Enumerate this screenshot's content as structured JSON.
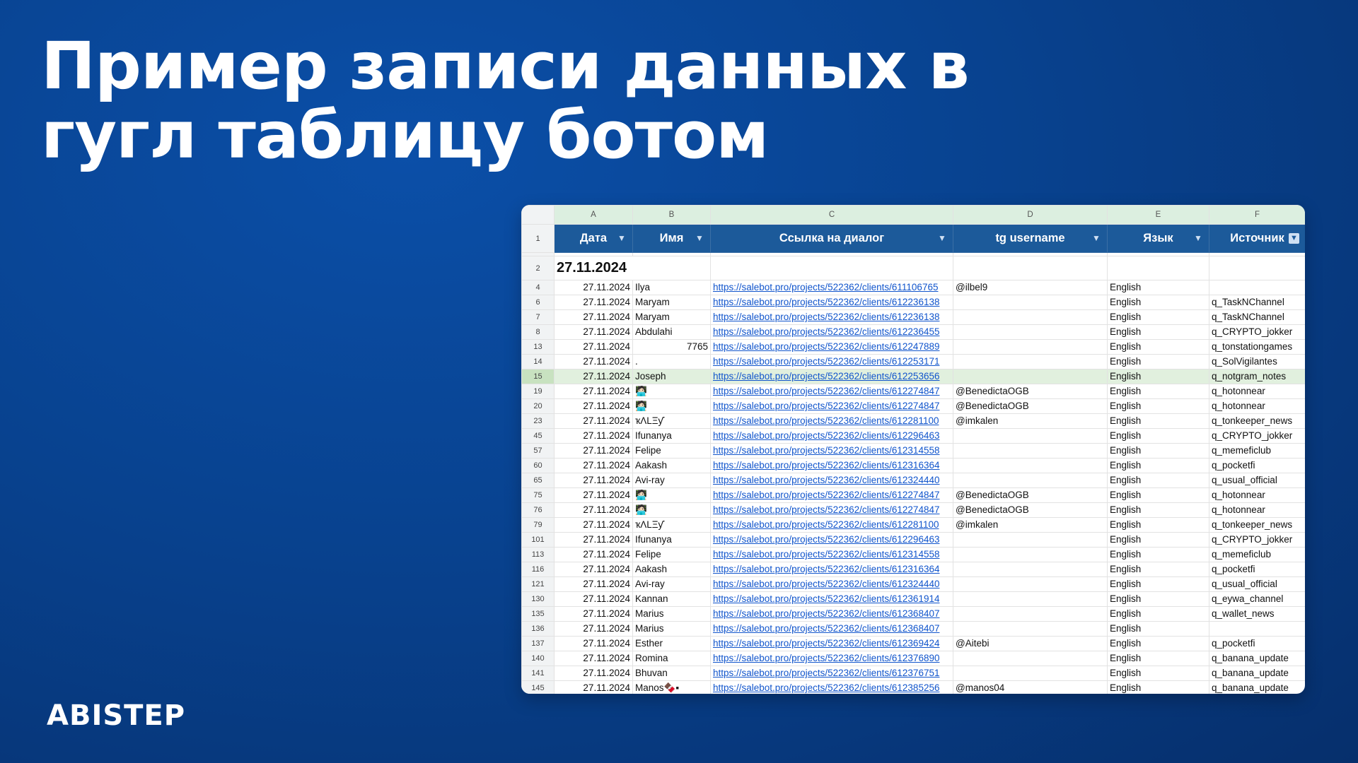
{
  "title": {
    "line1": "Пример записи данных в",
    "line2": "гугл таблицу ботом"
  },
  "brand": "ABISTEP",
  "sheet": {
    "column_letters": [
      "A",
      "B",
      "C",
      "D",
      "E",
      "F"
    ],
    "header_row_number": "1",
    "headers": [
      "Дата",
      "Имя",
      "Ссылка на диалог",
      "tg username",
      "Язык",
      "Источник"
    ],
    "group_row_number": "2",
    "group_date": "27.11.2024",
    "selected_row": "15",
    "rows": [
      {
        "n": "4",
        "date": "27.11.2024",
        "name": "Ilya",
        "link": "https://salebot.pro/projects/522362/clients/611106765",
        "user": "@ilbel9",
        "lang": "English",
        "src": ""
      },
      {
        "n": "6",
        "date": "27.11.2024",
        "name": "Maryam",
        "link": "https://salebot.pro/projects/522362/clients/612236138",
        "user": "",
        "lang": "English",
        "src": "q_TaskNChannel"
      },
      {
        "n": "7",
        "date": "27.11.2024",
        "name": "Maryam",
        "link": "https://salebot.pro/projects/522362/clients/612236138",
        "user": "",
        "lang": "English",
        "src": "q_TaskNChannel"
      },
      {
        "n": "8",
        "date": "27.11.2024",
        "name": "Abdulahi",
        "link": "https://salebot.pro/projects/522362/clients/612236455",
        "user": "",
        "lang": "English",
        "src": "q_CRYPTO_jokker"
      },
      {
        "n": "13",
        "date": "27.11.2024",
        "name": "7765",
        "link": "https://salebot.pro/projects/522362/clients/612247889",
        "user": "",
        "lang": "English",
        "src": "q_tonstationgames",
        "numeric": true
      },
      {
        "n": "14",
        "date": "27.11.2024",
        "name": ".",
        "link": "https://salebot.pro/projects/522362/clients/612253171",
        "user": "",
        "lang": "English",
        "src": "q_SolVigilantes"
      },
      {
        "n": "15",
        "date": "27.11.2024",
        "name": "Joseph",
        "link": "https://salebot.pro/projects/522362/clients/612253656",
        "user": "",
        "lang": "English",
        "src": "q_notgram_notes"
      },
      {
        "n": "19",
        "date": "27.11.2024",
        "name": "🧑🏻‍💻",
        "link": "https://salebot.pro/projects/522362/clients/612274847",
        "user": "@BenedictaOGB",
        "lang": "English",
        "src": "q_hotonnear"
      },
      {
        "n": "20",
        "date": "27.11.2024",
        "name": "🧑🏻‍💻",
        "link": "https://salebot.pro/projects/522362/clients/612274847",
        "user": "@BenedictaOGB",
        "lang": "English",
        "src": "q_hotonnear"
      },
      {
        "n": "23",
        "date": "27.11.2024",
        "name": "ҡΛLΞƴ",
        "link": "https://salebot.pro/projects/522362/clients/612281100",
        "user": "@imkalen",
        "lang": "English",
        "src": "q_tonkeeper_news"
      },
      {
        "n": "45",
        "date": "27.11.2024",
        "name": "Ifunanya",
        "link": "https://salebot.pro/projects/522362/clients/612296463",
        "user": "",
        "lang": "English",
        "src": "q_CRYPTO_jokker"
      },
      {
        "n": "57",
        "date": "27.11.2024",
        "name": "Felipe",
        "link": "https://salebot.pro/projects/522362/clients/612314558",
        "user": "",
        "lang": "English",
        "src": "q_memeficlub"
      },
      {
        "n": "60",
        "date": "27.11.2024",
        "name": "Aakash",
        "link": "https://salebot.pro/projects/522362/clients/612316364",
        "user": "",
        "lang": "English",
        "src": "q_pocketfi"
      },
      {
        "n": "65",
        "date": "27.11.2024",
        "name": "Avi-ray",
        "link": "https://salebot.pro/projects/522362/clients/612324440",
        "user": "",
        "lang": "English",
        "src": "q_usual_official"
      },
      {
        "n": "75",
        "date": "27.11.2024",
        "name": "🧑🏻‍💻",
        "link": "https://salebot.pro/projects/522362/clients/612274847",
        "user": "@BenedictaOGB",
        "lang": "English",
        "src": "q_hotonnear"
      },
      {
        "n": "76",
        "date": "27.11.2024",
        "name": "🧑🏻‍💻",
        "link": "https://salebot.pro/projects/522362/clients/612274847",
        "user": "@BenedictaOGB",
        "lang": "English",
        "src": "q_hotonnear"
      },
      {
        "n": "79",
        "date": "27.11.2024",
        "name": "ҡΛLΞƴ",
        "link": "https://salebot.pro/projects/522362/clients/612281100",
        "user": "@imkalen",
        "lang": "English",
        "src": "q_tonkeeper_news"
      },
      {
        "n": "101",
        "date": "27.11.2024",
        "name": "Ifunanya",
        "link": "https://salebot.pro/projects/522362/clients/612296463",
        "user": "",
        "lang": "English",
        "src": "q_CRYPTO_jokker"
      },
      {
        "n": "113",
        "date": "27.11.2024",
        "name": "Felipe",
        "link": "https://salebot.pro/projects/522362/clients/612314558",
        "user": "",
        "lang": "English",
        "src": "q_memeficlub"
      },
      {
        "n": "116",
        "date": "27.11.2024",
        "name": "Aakash",
        "link": "https://salebot.pro/projects/522362/clients/612316364",
        "user": "",
        "lang": "English",
        "src": "q_pocketfi"
      },
      {
        "n": "121",
        "date": "27.11.2024",
        "name": "Avi-ray",
        "link": "https://salebot.pro/projects/522362/clients/612324440",
        "user": "",
        "lang": "English",
        "src": "q_usual_official"
      },
      {
        "n": "130",
        "date": "27.11.2024",
        "name": "Kannan",
        "link": "https://salebot.pro/projects/522362/clients/612361914",
        "user": "",
        "lang": "English",
        "src": "q_eywa_channel"
      },
      {
        "n": "135",
        "date": "27.11.2024",
        "name": "Marius",
        "link": "https://salebot.pro/projects/522362/clients/612368407",
        "user": "",
        "lang": "English",
        "src": "q_wallet_news"
      },
      {
        "n": "136",
        "date": "27.11.2024",
        "name": "Marius",
        "link": "https://salebot.pro/projects/522362/clients/612368407",
        "user": "",
        "lang": "English",
        "src": ""
      },
      {
        "n": "137",
        "date": "27.11.2024",
        "name": "Esther",
        "link": "https://salebot.pro/projects/522362/clients/612369424",
        "user": "@Aitebi",
        "lang": "English",
        "src": "q_pocketfi"
      },
      {
        "n": "140",
        "date": "27.11.2024",
        "name": "Romina",
        "link": "https://salebot.pro/projects/522362/clients/612376890",
        "user": "",
        "lang": "English",
        "src": "q_banana_update"
      },
      {
        "n": "141",
        "date": "27.11.2024",
        "name": "Bhuvan",
        "link": "https://salebot.pro/projects/522362/clients/612376751",
        "user": "",
        "lang": "English",
        "src": "q_banana_update"
      },
      {
        "n": "145",
        "date": "27.11.2024",
        "name": "Manos🍫▪",
        "link": "https://salebot.pro/projects/522362/clients/612385256",
        "user": "@manos04",
        "lang": "English",
        "src": "q_banana_update"
      }
    ]
  },
  "icons": {
    "filter": "filter-icon",
    "filter_active": "filter-active-icon"
  }
}
